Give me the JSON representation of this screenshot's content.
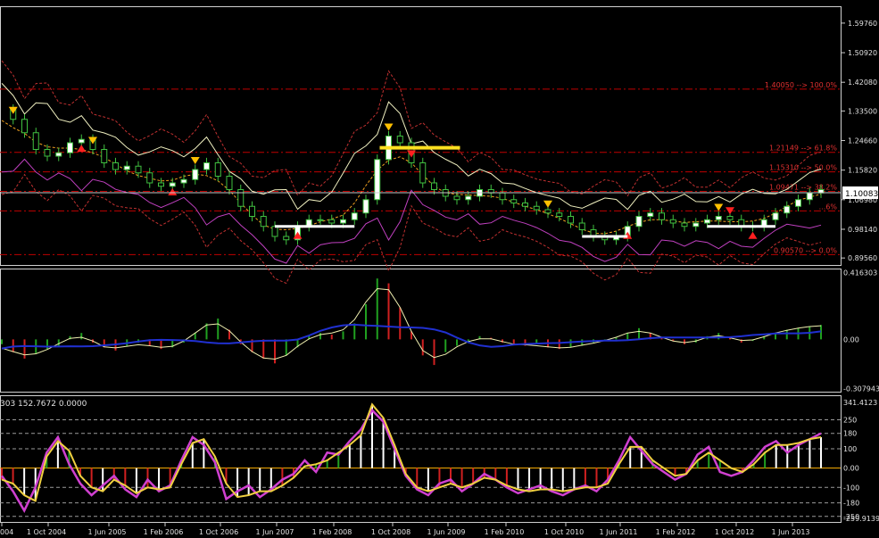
{
  "chart_data": [
    {
      "type": "candlestick",
      "pane": "main",
      "title": "",
      "y_ticks": [
        "1.59760",
        "1.50920",
        "1.42080",
        "1.33500",
        "1.24660",
        "1.15820",
        "1.06980",
        "0.98140",
        "0.89560"
      ],
      "ylim": [
        0.88,
        1.64
      ],
      "current_price": "1.10083",
      "fib_levels": [
        {
          "label": "1.40050 --> 100.0%",
          "price": 1.4005
        },
        {
          "label": "1.21149 --> 61.8%",
          "price": 1.21149
        },
        {
          "label": "1.15310 --> 50.0%",
          "price": 1.1531
        },
        {
          "label": "1.09471 --> 38.2%",
          "price": 1.09471
        },
        {
          "label": "...6%",
          "price": 1.03632
        },
        {
          "label": "0.90570 --> 0.0%",
          "price": 0.9057
        }
      ],
      "close_series": [
        1.34,
        1.31,
        1.27,
        1.22,
        1.2,
        1.21,
        1.24,
        1.25,
        1.22,
        1.18,
        1.16,
        1.17,
        1.15,
        1.12,
        1.11,
        1.12,
        1.13,
        1.16,
        1.18,
        1.14,
        1.1,
        1.05,
        1.02,
        0.99,
        0.96,
        0.95,
        0.99,
        1.01,
        1.01,
        1.0,
        1.01,
        1.03,
        1.07,
        1.19,
        1.26,
        1.24,
        1.18,
        1.12,
        1.1,
        1.08,
        1.07,
        1.08,
        1.1,
        1.09,
        1.07,
        1.06,
        1.05,
        1.04,
        1.03,
        1.02,
        1.0,
        0.98,
        0.96,
        0.95,
        0.96,
        0.99,
        1.02,
        1.03,
        1.01,
        1.0,
        0.99,
        1.0,
        1.01,
        1.02,
        1.01,
        0.99,
        0.99,
        1.01,
        1.03,
        1.05,
        1.07,
        1.09,
        1.1
      ]
    },
    {
      "type": "histogram",
      "pane": "oscillator",
      "y_ticks": [
        "0.416303",
        "0.00",
        "-0.307943"
      ],
      "ylim": [
        -0.31,
        0.42
      ],
      "values": [
        -0.03,
        -0.08,
        -0.12,
        -0.09,
        -0.06,
        -0.04,
        0.02,
        0.04,
        -0.02,
        -0.05,
        -0.07,
        -0.04,
        -0.02,
        -0.04,
        -0.06,
        -0.05,
        -0.02,
        0.04,
        0.1,
        0.13,
        0.06,
        -0.03,
        -0.08,
        -0.12,
        -0.15,
        -0.1,
        -0.05,
        0.02,
        0.04,
        0.03,
        0.05,
        0.1,
        0.22,
        0.38,
        0.35,
        0.2,
        0.05,
        -0.1,
        -0.16,
        -0.08,
        -0.04,
        -0.02,
        0.02,
        0.01,
        -0.02,
        -0.03,
        -0.04,
        -0.03,
        -0.05,
        -0.06,
        -0.05,
        -0.04,
        -0.02,
        -0.01,
        0.01,
        0.04,
        0.07,
        0.04,
        0.01,
        -0.01,
        -0.03,
        -0.02,
        0.02,
        0.04,
        0.01,
        -0.02,
        -0.01,
        0.02,
        0.04,
        0.06,
        0.07,
        0.08,
        0.09
      ]
    },
    {
      "type": "line",
      "pane": "cci",
      "header": "303 152.7672 0.0000",
      "y_ticks": [
        "341.4123",
        "250",
        "180",
        "100",
        "0.00",
        "-100",
        "-180",
        "-250",
        "-259.9139"
      ],
      "ylim": [
        -265,
        345
      ],
      "x_ticks": [
        "004",
        "1 Oct 2004",
        "1 Jun 2005",
        "1 Feb 2006",
        "1 Oct 2006",
        "1 Jun 2007",
        "1 Feb 2008",
        "1 Oct 2008",
        "1 Jun 2009",
        "1 Feb 2010",
        "1 Oct 2010",
        "1 Jun 2011",
        "1 Feb 2012",
        "1 Oct 2012",
        "1 Jun 2013"
      ],
      "series": [
        {
          "values": [
            -40,
            -120,
            -220,
            -100,
            80,
            160,
            20,
            -80,
            -140,
            -90,
            -40,
            -110,
            -150,
            -60,
            -120,
            -90,
            40,
            160,
            120,
            30,
            -160,
            -120,
            -90,
            -150,
            -110,
            -60,
            -30,
            40,
            -20,
            80,
            70,
            140,
            200,
            300,
            240,
            100,
            -40,
            -110,
            -140,
            -80,
            -60,
            -120,
            -80,
            -30,
            -60,
            -100,
            -130,
            -110,
            -90,
            -120,
            -140,
            -110,
            -90,
            -120,
            -60,
            40,
            160,
            90,
            20,
            -20,
            -60,
            -30,
            70,
            110,
            -20,
            -40,
            -20,
            40,
            110,
            140,
            80,
            120,
            150,
            180
          ]
        },
        {
          "values": [
            -60,
            -80,
            -140,
            -170,
            60,
            140,
            90,
            -40,
            -100,
            -120,
            -60,
            -90,
            -130,
            -100,
            -110,
            -100,
            20,
            130,
            150,
            60,
            -80,
            -150,
            -140,
            -120,
            -120,
            -90,
            -50,
            10,
            20,
            40,
            80,
            120,
            170,
            330,
            260,
            120,
            -30,
            -100,
            -120,
            -100,
            -80,
            -100,
            -80,
            -50,
            -60,
            -90,
            -110,
            -120,
            -110,
            -110,
            -120,
            -110,
            -100,
            -100,
            -80,
            20,
            110,
            110,
            40,
            0,
            -40,
            -30,
            40,
            80,
            40,
            0,
            -20,
            20,
            80,
            120,
            120,
            130,
            150,
            160
          ]
        }
      ]
    }
  ]
}
